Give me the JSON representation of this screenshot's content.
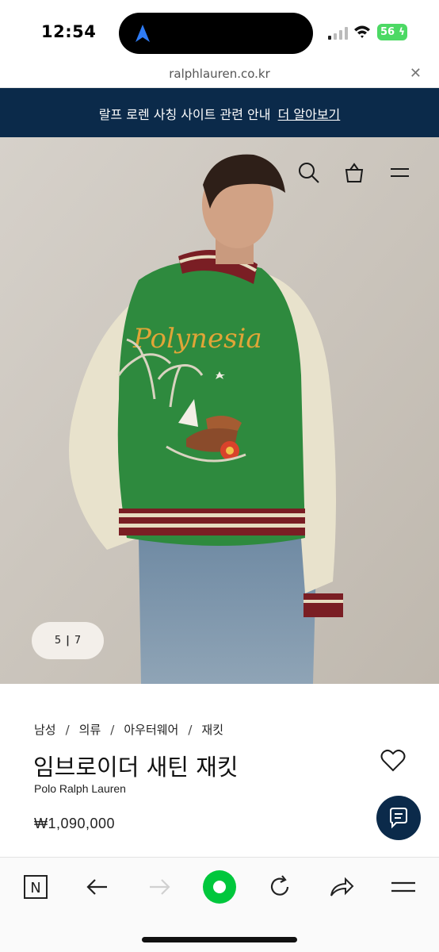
{
  "status_bar": {
    "time": "12:54",
    "battery": "56",
    "icons": [
      "navigation-arrow-icon",
      "signal-icon",
      "wifi-icon",
      "battery-icon"
    ]
  },
  "url_bar": {
    "url": "ralphlauren.co.kr",
    "close_icon": "close-icon"
  },
  "banner": {
    "text": "랄프 로렌 사칭 사이트 관련 안내",
    "link": "더 알아보기"
  },
  "hero": {
    "image_text": "Polynesia",
    "header_icons": [
      "search-icon",
      "shopping-bag-icon",
      "menu-icon"
    ],
    "pager": {
      "current": "5",
      "total": "7"
    }
  },
  "product": {
    "breadcrumb": [
      "남성",
      "의류",
      "아우터웨어",
      "재킷"
    ],
    "title": "임브로이더 새틴 재킷",
    "brand": "Polo Ralph Lauren",
    "price": "₩1,090,000",
    "wishlist_icon": "heart-icon",
    "chat_icon": "chat-icon"
  },
  "browser_toolbar": {
    "items": [
      "naver-n-icon",
      "back-arrow-icon",
      "forward-arrow-icon",
      "green-home-icon",
      "reload-icon",
      "share-icon",
      "menu-icon"
    ]
  },
  "colors": {
    "navy": "#0b2a4a",
    "green": "#00c73c",
    "battery": "#4cd964"
  }
}
